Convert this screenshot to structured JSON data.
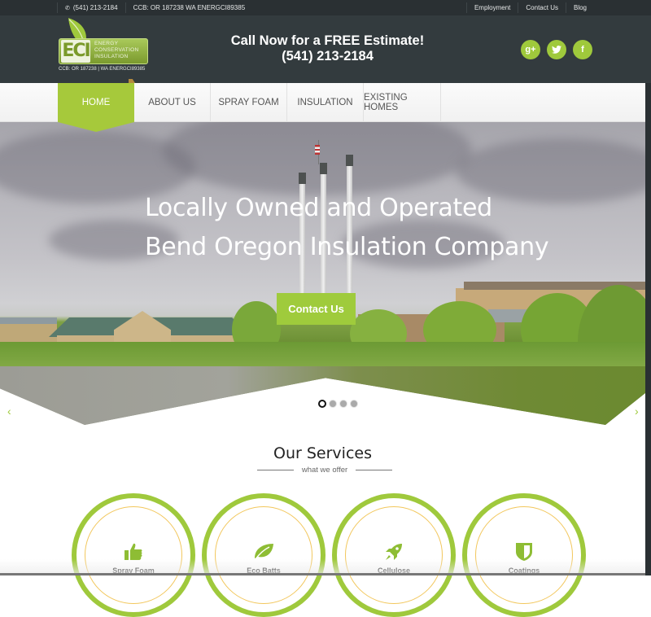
{
  "topbar": {
    "phone": "(541) 213-2184",
    "license": "CCB: OR 187238 WA ENERGCI89385",
    "links": [
      "Employment",
      "Contact Us",
      "Blog"
    ]
  },
  "header": {
    "logo": {
      "abbr": "ECI",
      "line1": "ENERGY",
      "line2": "CONSERVATION",
      "line3": "INSULATION",
      "ccb": "CCB: OR 187238 | WA ENERGCI89385"
    },
    "cta_line1": "Call Now for a FREE Estimate!",
    "cta_line2": "(541) 213-2184",
    "social": [
      {
        "name": "google-plus-icon",
        "glyph": "g+"
      },
      {
        "name": "twitter-icon",
        "glyph": "t"
      },
      {
        "name": "facebook-icon",
        "glyph": "f"
      }
    ]
  },
  "nav": {
    "items": [
      {
        "label": "HOME",
        "active": true
      },
      {
        "label": "ABOUT US"
      },
      {
        "label": "SPRAY FOAM"
      },
      {
        "label": "INSULATION"
      },
      {
        "label": "EXISTING HOMES"
      }
    ]
  },
  "hero": {
    "heading_line1": "Locally Owned and Operated",
    "heading_line2": "Bend Oregon Insulation Company",
    "button": "Contact Us",
    "slides_total": 4,
    "active_slide": 1,
    "prev": "‹",
    "next": "›"
  },
  "services": {
    "title": "Our Services",
    "subtitle": "what we offer",
    "items": [
      {
        "label": "Spray Foam",
        "icon": "thumbs-up-icon"
      },
      {
        "label": "Eco Batts",
        "icon": "leaf-icon"
      },
      {
        "label": "Cellulose",
        "icon": "rocket-icon"
      },
      {
        "label": "Coatings",
        "icon": "shield-icon"
      }
    ]
  },
  "colors": {
    "accent": "#9fc93c",
    "header": "#333b3e",
    "topbar": "#2a3033"
  }
}
